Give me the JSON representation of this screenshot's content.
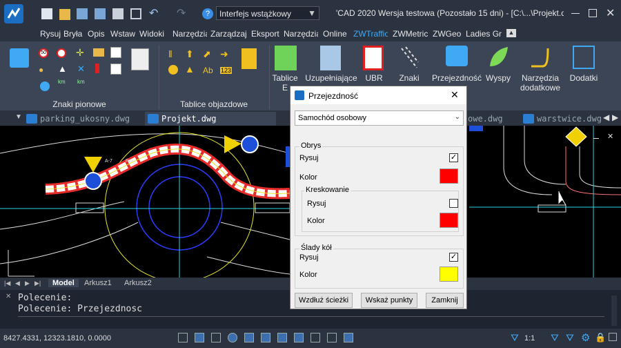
{
  "titlebar": {
    "workspace": "Interfejs wstążkowy",
    "title": "'CAD 2020 Wersja testowa (Pozostało 15 dni) - [C:\\...\\Projekt.dw"
  },
  "menu": [
    "Rysuj",
    "Bryła",
    "Opis",
    "Wstaw",
    "Widoki",
    "Narzędzia",
    "Zarządzaj",
    "Eksport",
    "Narzędzia",
    "Online",
    "ZWTraffic",
    "ZWMetric",
    "ZWGeo",
    "Ladies Gr"
  ],
  "menu_active": "ZWTraffic",
  "ribbon": {
    "groups": [
      "Znaki pionowe",
      "Tablice objazdowe"
    ],
    "buttons": [
      {
        "label": "Tablice",
        "label2": "E"
      },
      {
        "label": "Uzupełniające",
        "label2": ""
      },
      {
        "label": "UBR",
        "label2": ""
      },
      {
        "label": "Znaki",
        "label2": ""
      },
      {
        "label": "Przejezdność",
        "label2": ""
      },
      {
        "label": "Wyspy",
        "label2": ""
      },
      {
        "label": "Narzędzia",
        "label2": "dodatkowe"
      },
      {
        "label": "Dodatki",
        "label2": ""
      }
    ],
    "small_labels": [
      "Ab",
      "123",
      "km",
      "km"
    ]
  },
  "tabs": [
    {
      "name": "parking_ukosny.dwg",
      "active": false
    },
    {
      "name": "Projekt.dwg",
      "active": true
    },
    {
      "name": "owe.dwg",
      "active": false
    },
    {
      "name": "warstwice.dwg",
      "active": false
    }
  ],
  "layout_tabs": [
    "Model",
    "Arkusz1",
    "Arkusz2"
  ],
  "command": {
    "lines": [
      "Polecenie:",
      "Polecenie: Przejezdnosc"
    ]
  },
  "status": {
    "coords": "8427.4331, 12323.1810, 0.0000",
    "scale": "1:1"
  },
  "canvas_labels": [
    "A-7",
    "Pro"
  ],
  "dialog": {
    "title": "Przejezdność",
    "vehicle": "Samochód osobowy",
    "obrys": {
      "label": "Obrys",
      "rysuj_label": "Rysuj",
      "rysuj_checked": true,
      "kolor_label": "Kolor",
      "kolor": "#ff0000"
    },
    "kreskowanie": {
      "label": "Kreskowanie",
      "rysuj_label": "Rysuj",
      "rysuj_checked": false,
      "kolor_label": "Kolor",
      "kolor": "#ff0000"
    },
    "slady": {
      "label": "Ślady kół",
      "rysuj_label": "Rysuj",
      "rysuj_checked": true,
      "kolor_label": "Kolor",
      "kolor": "#ffff00"
    },
    "buttons": {
      "along_path": "Wzdłuż ścieżki",
      "pick_points": "Wskaż punkty",
      "close": "Zamknij"
    }
  }
}
